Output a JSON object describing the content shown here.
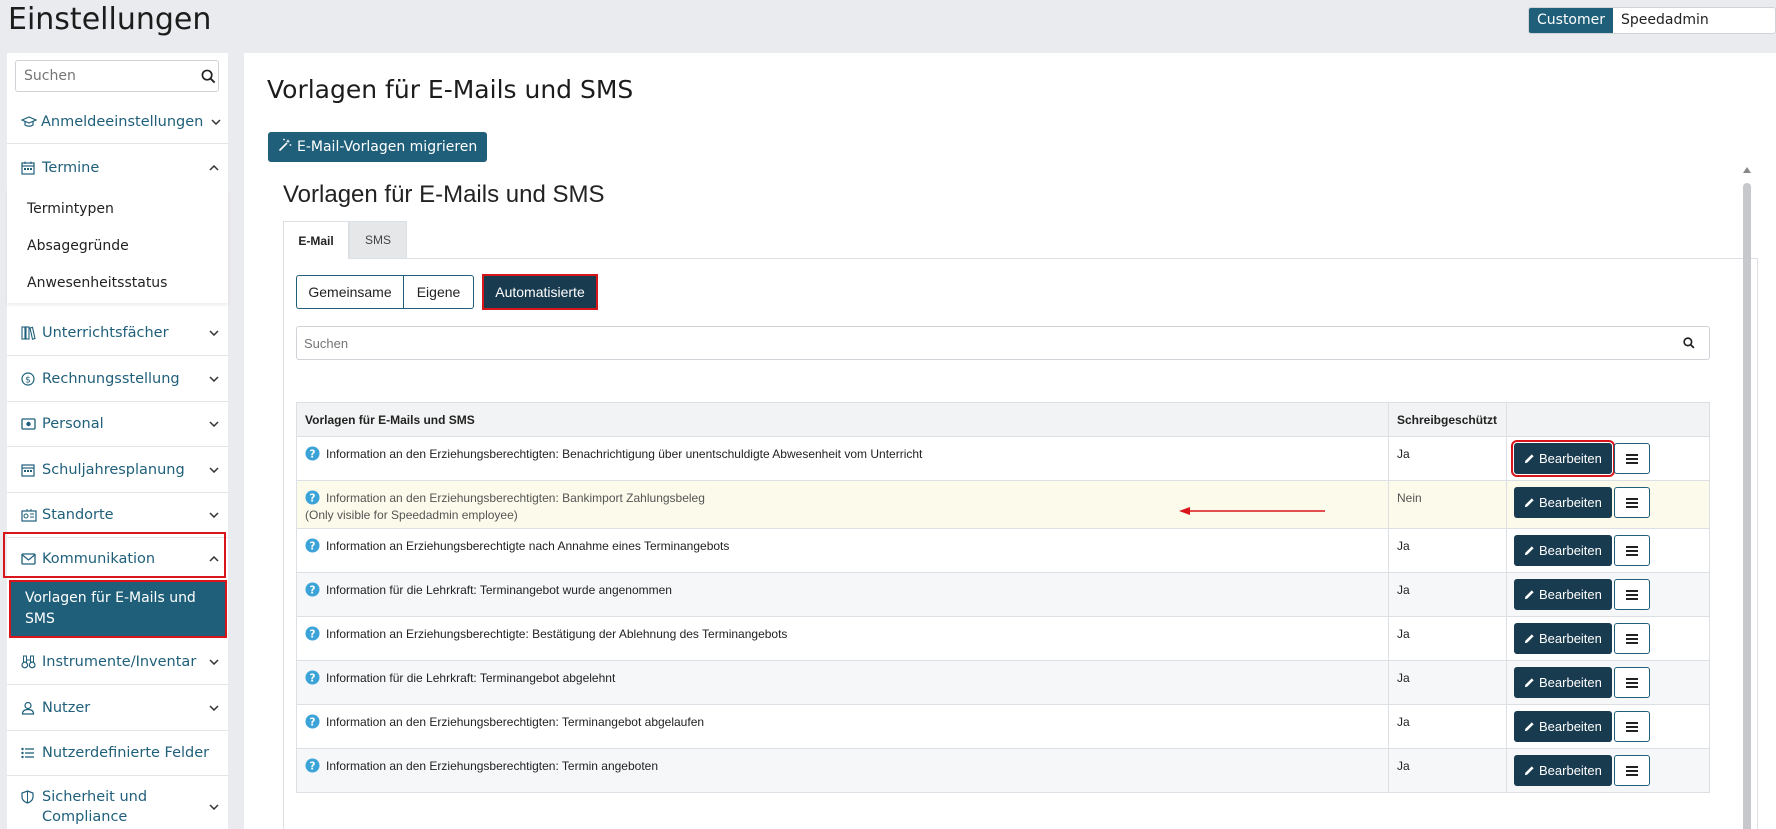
{
  "header": {
    "title": "Einstellungen",
    "roles": [
      "Customer",
      "Speedadmin Employee"
    ]
  },
  "sidebar": {
    "search_placeholder": "Suchen",
    "sections": [
      {
        "label": "Anmeldeeinstellungen",
        "icon": "graduation-cap-icon"
      },
      {
        "label": "Termine",
        "icon": "calendar-icon",
        "expanded": true
      },
      {
        "label": "Unterrichtsfächer",
        "icon": "books-icon"
      },
      {
        "label": "Rechnungsstellung",
        "icon": "dollar-coin-icon"
      },
      {
        "label": "Personal",
        "icon": "id-card-icon"
      },
      {
        "label": "Schuljahresplanung",
        "icon": "calendar-icon"
      },
      {
        "label": "Standorte",
        "icon": "building-icon"
      },
      {
        "label": "Kommunikation",
        "icon": "envelope-icon",
        "expanded": true
      },
      {
        "label": "Instrumente/Inventar",
        "icon": "binoculars-icon"
      },
      {
        "label": "Nutzer",
        "icon": "user-icon"
      },
      {
        "label": "Nutzerdefinierte Felder",
        "icon": "list-icon"
      },
      {
        "label": "Sicherheit und Compliance",
        "icon": "shield-icon"
      }
    ],
    "termine_items": [
      "Termintypen",
      "Absagegründe",
      "Anwesenheitsstatus"
    ],
    "kommunikation_item": "Vorlagen für E-Mails und SMS"
  },
  "main": {
    "title": "Vorlagen für E-Mails und SMS",
    "migrate_button": "E-Mail-Vorlagen migrieren",
    "panel_title": "Vorlagen für E-Mails und SMS",
    "tabs": [
      "E-Mail",
      "SMS"
    ],
    "filters": [
      "Gemeinsame",
      "Eigene",
      "Automatisierte"
    ],
    "search_placeholder": "Suchen",
    "table": {
      "columns": [
        "Vorlagen für E-Mails und SMS",
        "Schreibgeschützt",
        ""
      ],
      "edit_label": "Bearbeiten",
      "rows": [
        {
          "name": "Information an den Erziehungsberechtigten: Benachrichtigung über unentschuldigte Abwesenheit vom Unterricht",
          "note": "",
          "readonly": "Ja"
        },
        {
          "name": "Information an den Erziehungsberechtigten: Bankimport Zahlungsbeleg",
          "note": "(Only visible for Speedadmin employee)",
          "readonly": "Nein"
        },
        {
          "name": "Information an Erziehungsberechtigte nach Annahme eines Terminangebots",
          "note": "",
          "readonly": "Ja"
        },
        {
          "name": "Information für die Lehrkraft: Terminangebot wurde angenommen",
          "note": "",
          "readonly": "Ja"
        },
        {
          "name": "Information an Erziehungsberechtigte: Bestätigung der Ablehnung des Terminangebots",
          "note": "",
          "readonly": "Ja"
        },
        {
          "name": "Information für die Lehrkraft: Terminangebot abgelehnt",
          "note": "",
          "readonly": "Ja"
        },
        {
          "name": "Information an den Erziehungsberechtigten: Terminangebot abgelaufen",
          "note": "",
          "readonly": "Ja"
        },
        {
          "name": "Information an den Erziehungsberechtigten: Termin angeboten",
          "note": "",
          "readonly": "Ja"
        }
      ]
    }
  },
  "colors": {
    "brand": "#1f5f7a",
    "dark_button": "#183b4f",
    "highlight_red": "#d9151c",
    "info_blue": "#3ba3d8"
  }
}
